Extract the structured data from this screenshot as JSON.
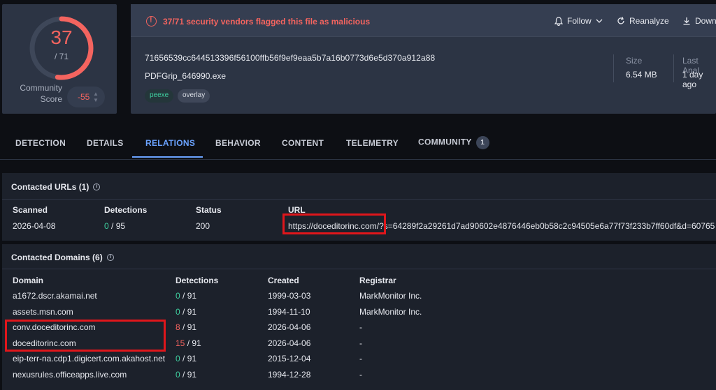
{
  "score": {
    "detections": "37",
    "total": "/ 71",
    "community_label_1": "Community",
    "community_label_2": "Score",
    "community_value": "-55",
    "gauge_fraction": 0.521
  },
  "header": {
    "alert": "37/71 security vendors flagged this file as malicious",
    "follow_label": "Follow",
    "reanalyze_label": "Reanalyze",
    "download_label": "Down",
    "hash": "71656539cc644513396f56100ffb56f9ef9eaa5b7a16b0773d6e5d370a912a88",
    "filename": "PDFGrip_646990.exe",
    "tags": [
      "peexe",
      "overlay"
    ],
    "size_label": "Size",
    "size_value": "6.54 MB",
    "last_label": "Last Anal",
    "last_value": "1 day ago"
  },
  "tabs": {
    "detection": "DETECTION",
    "details": "DETAILS",
    "relations": "RELATIONS",
    "behavior": "BEHAVIOR",
    "content": "CONTENT",
    "telemetry": "TELEMETRY",
    "community": "COMMUNITY",
    "community_count": "1"
  },
  "urls": {
    "title": "Contacted URLs",
    "count": "(1)",
    "headers": {
      "scanned": "Scanned",
      "detections": "Detections",
      "status": "Status",
      "url": "URL"
    },
    "row": {
      "scanned": "2026-04-08",
      "det_pos": "0",
      "det_total": "/ 95",
      "status": "200",
      "url_host": "https://doceditorinc.com/",
      "url_query": "?s=64289f2a29261d7ad90602e4876446eb0b58c2c94505e6a77f73f233b7ff60df&d=60765"
    }
  },
  "domains": {
    "title": "Contacted Domains",
    "count": "(6)",
    "headers": {
      "domain": "Domain",
      "detections": "Detections",
      "created": "Created",
      "registrar": "Registrar"
    },
    "rows": [
      {
        "domain": "a1672.dscr.akamai.net",
        "det_pos": "0",
        "det_total": "/ 91",
        "malicious": false,
        "created": "1999-03-03",
        "registrar": "MarkMonitor Inc."
      },
      {
        "domain": "assets.msn.com",
        "det_pos": "0",
        "det_total": "/ 91",
        "malicious": false,
        "created": "1994-11-10",
        "registrar": "MarkMonitor Inc."
      },
      {
        "domain": "conv.doceditorinc.com",
        "det_pos": "8",
        "det_total": "/ 91",
        "malicious": true,
        "created": "2026-04-06",
        "registrar": "-"
      },
      {
        "domain": "doceditorinc.com",
        "det_pos": "15",
        "det_total": "/ 91",
        "malicious": true,
        "created": "2026-04-06",
        "registrar": "-"
      },
      {
        "domain": "eip-terr-na.cdp1.digicert.com.akahost.net",
        "det_pos": "0",
        "det_total": "/ 91",
        "malicious": false,
        "created": "2015-12-04",
        "registrar": "-"
      },
      {
        "domain": "nexusrules.officeapps.live.com",
        "det_pos": "0",
        "det_total": "/ 91",
        "malicious": false,
        "created": "1994-12-28",
        "registrar": "-"
      }
    ]
  },
  "colors": {
    "malicious": "#f4645f",
    "clean": "#3fd0a0",
    "accent": "#6ba3ff",
    "highlight": "#e0161b"
  }
}
